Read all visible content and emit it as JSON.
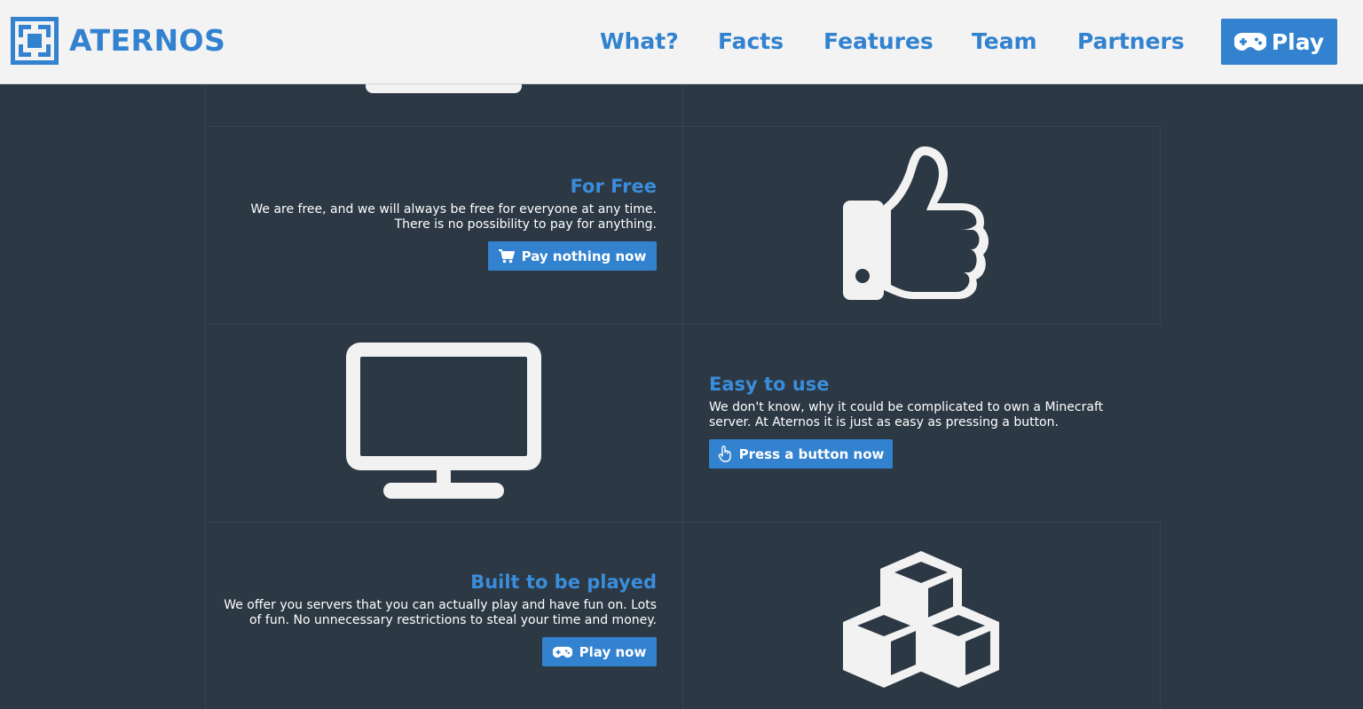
{
  "header": {
    "logo_text": "ATERNOS",
    "nav": [
      {
        "label": "What?"
      },
      {
        "label": "Facts"
      },
      {
        "label": "Features"
      },
      {
        "label": "Team"
      },
      {
        "label": "Partners"
      }
    ],
    "play_label": "Play"
  },
  "features": [
    {
      "title": "For Free",
      "lines": [
        "We are free, and we will always be free for everyone at any time.",
        "There is no possibility to pay for anything."
      ],
      "button": "Pay nothing now",
      "button_icon": "cart-icon",
      "illustration": "thumbs-up-icon"
    },
    {
      "title": "Easy to use",
      "lines": [
        "We don't know, why it could be complicated to own a Minecraft",
        "server. At Aternos it is just as easy as pressing a button."
      ],
      "button": "Press a button now",
      "button_icon": "pointer-hand-icon",
      "illustration": "monitor-icon"
    },
    {
      "title": "Built to be played",
      "lines": [
        "We offer you servers that you can actually play and have fun on. Lots",
        "of fun. No unnecessary restrictions to steal your time and money."
      ],
      "button": "Play now",
      "button_icon": "gamepad-icon",
      "illustration": "cubes-icon"
    }
  ],
  "colors": {
    "accent": "#3282d0",
    "background": "#2c3844",
    "header_bg": "#f3f3f3",
    "icon_fill": "#f2f2f2"
  }
}
